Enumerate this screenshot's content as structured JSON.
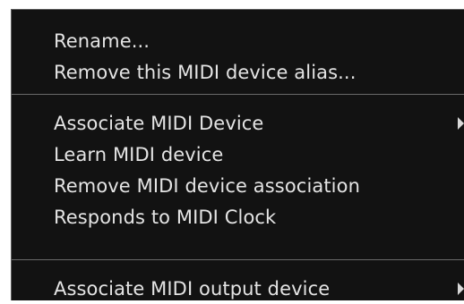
{
  "menu": {
    "items": [
      {
        "label": "Rename...",
        "submenu": false
      },
      {
        "label": "Remove this MIDI device alias...",
        "submenu": false
      },
      {
        "label": "Associate MIDI Device",
        "submenu": true
      },
      {
        "label": "Learn MIDI device",
        "submenu": false
      },
      {
        "label": "Remove MIDI device association",
        "submenu": false
      },
      {
        "label": "Responds to MIDI Clock",
        "submenu": false
      },
      {
        "label": "Associate MIDI output device",
        "submenu": true
      }
    ]
  },
  "colors": {
    "menu_background": "#121212",
    "text": "#e4e4e4",
    "separator": "#6a6a6a",
    "page_background": "#ffffff"
  },
  "icons": [
    "submenu-arrow-icon"
  ]
}
